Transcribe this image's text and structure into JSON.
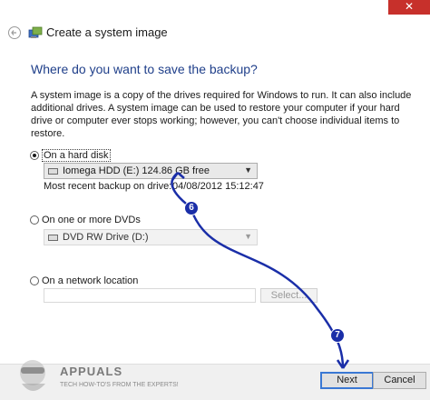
{
  "window": {
    "title": "Create a system image",
    "close_glyph": "✕"
  },
  "page": {
    "heading": "Where do you want to save the backup?",
    "description": "A system image is a copy of the drives required for Windows to run. It can also include additional drives. A system image can be used to restore your computer if your hard drive or computer ever stops working; however, you can't choose individual items to restore."
  },
  "options": {
    "hard_disk": {
      "label": "On a hard disk",
      "selected": true,
      "drive": "Iomega HDD (E:)  124.86 GB free",
      "recent_backup_label": "Most recent backup on drive:",
      "recent_backup_value": "04/08/2012 15:12:47"
    },
    "dvd": {
      "label": "On one or more DVDs",
      "selected": false,
      "drive": "DVD RW Drive (D:)"
    },
    "network": {
      "label": "On a network location",
      "selected": false,
      "location_value": "",
      "select_label": "Select..."
    }
  },
  "footer": {
    "next_label": "Next",
    "cancel_label": "Cancel"
  },
  "annotations": {
    "step_a": "6",
    "step_b": "7"
  },
  "watermark": {
    "name": "APPUALS",
    "tagline": "TECH HOW-TO'S FROM THE EXPERTS!"
  },
  "colors": {
    "heading": "#1f3f8a",
    "close": "#c7302b",
    "annotation": "#1a2ea8",
    "next_focus": "#3a78d4"
  }
}
